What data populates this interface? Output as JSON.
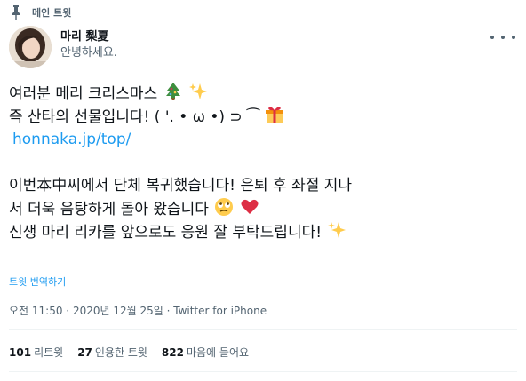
{
  "pinned_label": "메인 트윗",
  "author": {
    "display_name": "마리 梨夏",
    "handle": "안녕하세요."
  },
  "tweet": {
    "line1": "여러분 메리 크리스마스",
    "line2": "즉 산타의 선물입니다! ( '. • ω •) ⊃ ⁀",
    "link": "honnaka.jp/top/",
    "line4": "이번本中씨에서 단체 복귀했습니다! 은퇴 후 좌절 지나",
    "line5": "서 더욱 음탕하게 돌아 왔습니다",
    "line6": "신생 마리 리카를 앞으로도 응원 잘 부탁드립니다!",
    "icons": [
      "christmas-tree-icon",
      "sparkles-icon",
      "gift-icon",
      "rolling-eyes-face-icon",
      "red-heart-icon"
    ]
  },
  "translate_label": "트윗 번역하기",
  "meta": {
    "time": "오전 11:50",
    "sep": " · ",
    "date": "2020년 12월 25일",
    "source": "Twitter for iPhone"
  },
  "stats": {
    "retweets_count": "101",
    "retweets_label": "리트윗",
    "quotes_count": "27",
    "quotes_label": "인용한 트윗",
    "likes_count": "822",
    "likes_label": "마음에 들어요"
  },
  "colors": {
    "link": "#1d9bf0",
    "secondary_text": "#536471",
    "primary_text": "#0f1419"
  }
}
